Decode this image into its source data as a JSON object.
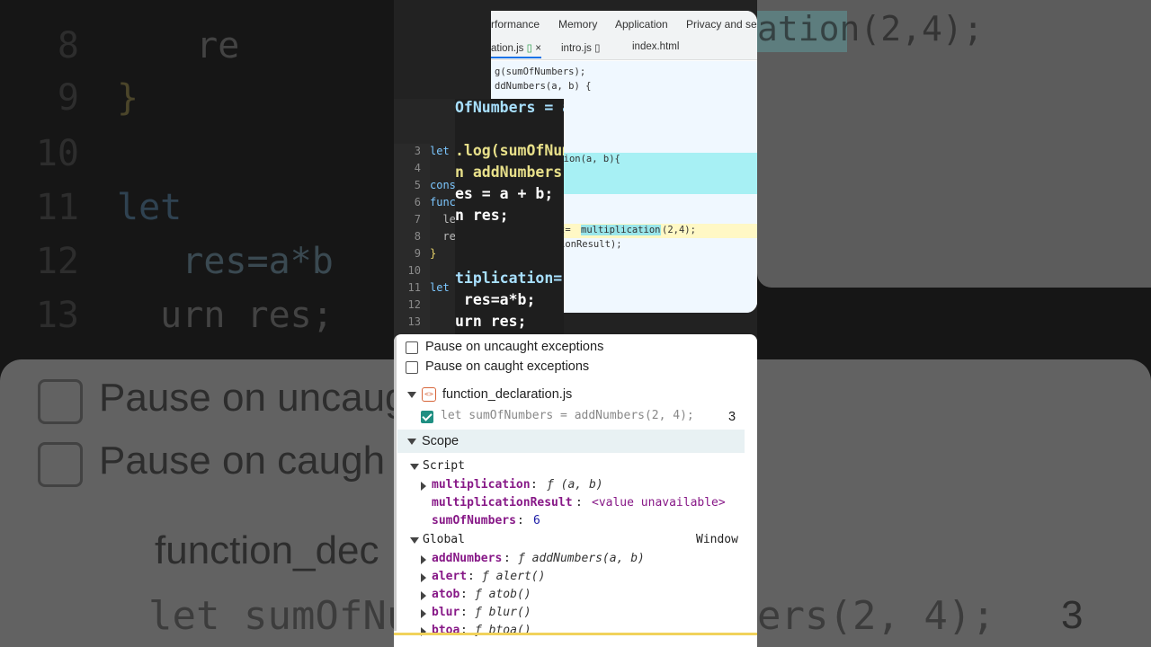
{
  "devtools": {
    "tabs": [
      "rformance",
      "Memory",
      "Application",
      "Privacy and sec"
    ],
    "files": [
      {
        "label": "ation.js"
      },
      {
        "label": "intro.js"
      },
      {
        "label": "index.html"
      }
    ],
    "code_lines": [
      "g(sumOfNumbers);",
      "ddNumbers(a, b) {",
      "ction(a, b){",
      "t= ",
      "multiplication",
      "(2,4);",
      "ionResult);"
    ]
  },
  "editor": {
    "gutter": [
      "3",
      "4",
      "5",
      "6",
      "7",
      "8",
      "9",
      "10",
      "11",
      "12",
      "13"
    ],
    "small_code": [
      "let",
      "",
      "cons",
      "func",
      "  le",
      "  re",
      "}",
      "",
      "let",
      "",
      ""
    ],
    "zoom_lines": [
      "OfNumbers = a",
      "",
      ".log(sumOfNum",
      "n addNumbers(",
      "es = a + b;",
      "n res;",
      "",
      "",
      "tiplication=",
      " res=a*b;",
      "urn res;"
    ]
  },
  "scope_panel": {
    "pause_uncaught": "Pause on uncaught exceptions",
    "pause_caught": "Pause on caught exceptions",
    "breakpoint_file": "function_declaration.js",
    "breakpoint_code": "let sumOfNumbers = addNumbers(2, 4);",
    "breakpoint_line": "3",
    "scope_label": "Scope",
    "script_label": "Script",
    "script_vars": [
      {
        "name": "multiplication",
        "value": "ƒ (a, b)"
      },
      {
        "name": "multiplicationResult",
        "value": "<value unavailable>"
      },
      {
        "name": "sumOfNumbers",
        "value": "6"
      }
    ],
    "global_label": "Global",
    "global_value": "Window",
    "global_vars": [
      {
        "name": "addNumbers",
        "value": "ƒ addNumbers(a, b)"
      },
      {
        "name": "alert",
        "value": "ƒ alert()"
      },
      {
        "name": "atob",
        "value": "ƒ atob()"
      },
      {
        "name": "blur",
        "value": "ƒ blur()"
      },
      {
        "name": "btoa",
        "value": "ƒ btoa()"
      }
    ]
  },
  "background": {
    "editor_lines": [
      {
        "num": "8",
        "code": "  re"
      },
      {
        "num": "9",
        "code": "}"
      },
      {
        "num": "10",
        "code": ""
      },
      {
        "num": "11",
        "code": "let"
      },
      {
        "num": "12",
        "code": "   res=a*b"
      },
      {
        "num": "13",
        "code": "  urn res;"
      }
    ],
    "zoom_right": "ation(2,4);",
    "zoom_uncaught": "Pause on uncaug",
    "zoom_caught": "Pause on caugh",
    "zoom_file": "function_dec",
    "zoom_code": "let sumOfNu",
    "zoom_code_right": "ers(2, 4);",
    "zoom_line": "3"
  }
}
